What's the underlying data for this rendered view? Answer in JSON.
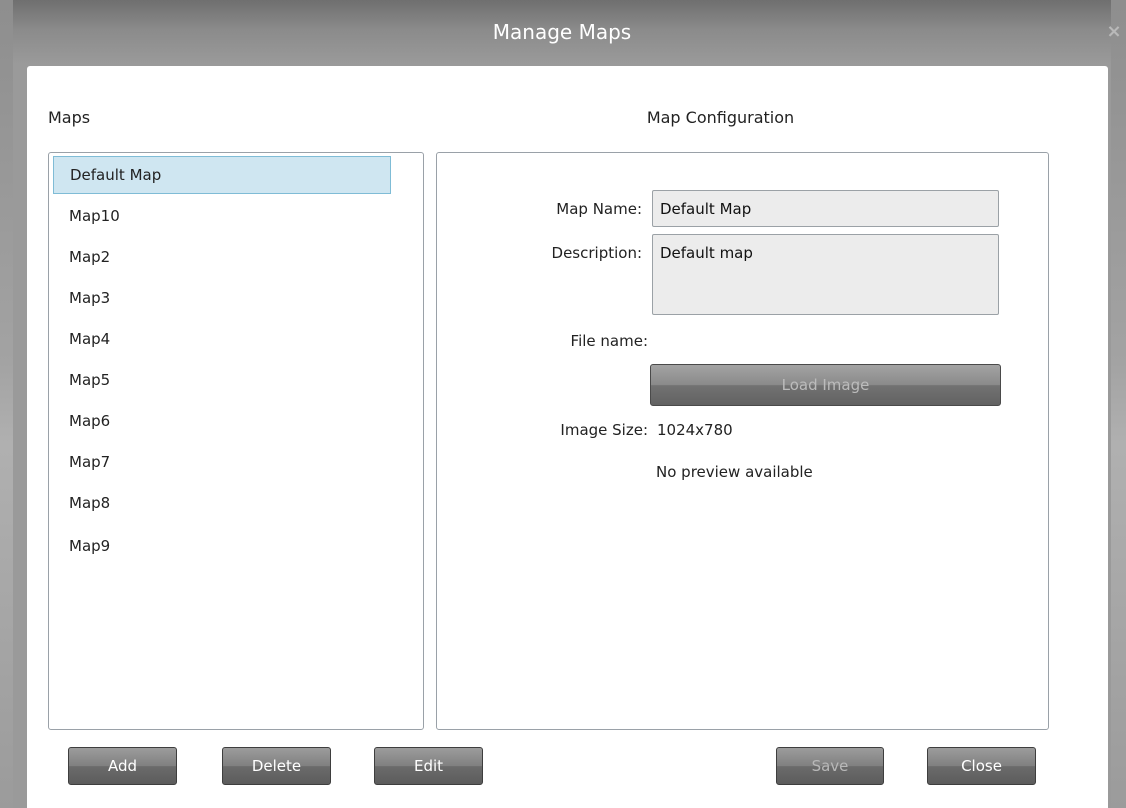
{
  "window": {
    "title": "Manage Maps",
    "close_glyph": "×"
  },
  "maps_panel": {
    "label": "Maps",
    "items": [
      {
        "label": "Default Map",
        "selected": true
      },
      {
        "label": "Map10",
        "selected": false
      },
      {
        "label": "Map2",
        "selected": false
      },
      {
        "label": "Map3",
        "selected": false
      },
      {
        "label": "Map4",
        "selected": false
      },
      {
        "label": "Map5",
        "selected": false
      },
      {
        "label": "Map6",
        "selected": false
      },
      {
        "label": "Map7",
        "selected": false
      },
      {
        "label": "Map8",
        "selected": false
      },
      {
        "label": "Map9",
        "selected": false
      }
    ]
  },
  "config_panel": {
    "label": "Map Configuration",
    "map_name_label": "Map Name:",
    "map_name_value": "Default Map",
    "description_label": "Description:",
    "description_value": "Default map",
    "file_name_label": "File name:",
    "load_image_label": "Load Image",
    "image_size_label": "Image Size:",
    "image_size_value": "1024x780",
    "preview_text": "No preview available"
  },
  "buttons": {
    "add": "Add",
    "delete": "Delete",
    "edit": "Edit",
    "save": "Save",
    "close": "Close"
  },
  "colors": {
    "selected_item_bg": "#cfe6f1",
    "selected_item_border": "#7fbcd6",
    "button_bg": "#808080",
    "title_bar": "#7a7a7a"
  }
}
